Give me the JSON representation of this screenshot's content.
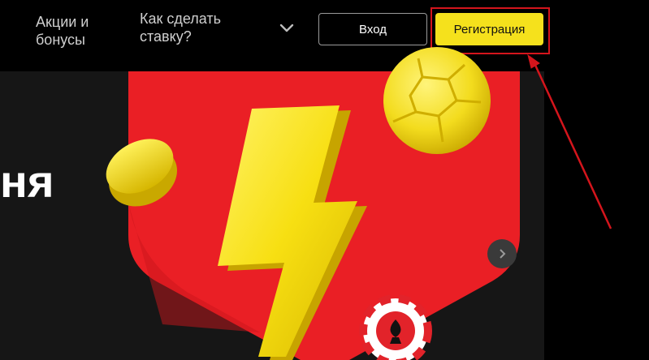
{
  "header": {
    "nav": [
      {
        "label_line1": "Акции и",
        "label_line2": "бонусы"
      },
      {
        "label_line1": "Как сделать",
        "label_line2": "ставку?"
      }
    ],
    "login_label": "Вход",
    "register_label": "Регистрация"
  },
  "banner": {
    "headline_fragment": "ня"
  },
  "colors": {
    "accent_yellow": "#f5e11c",
    "highlight_red": "#d4151c",
    "shield_red": "#ea1f25"
  },
  "icons": [
    "chevron-down-icon",
    "chevron-right-icon"
  ]
}
